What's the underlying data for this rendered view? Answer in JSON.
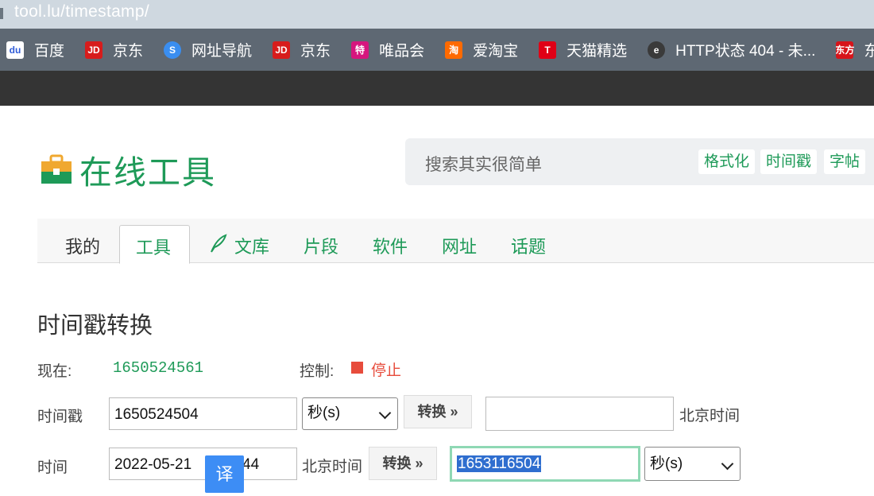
{
  "browser": {
    "url": "tool.lu/timestamp/",
    "bookmarks": [
      {
        "label": "百度",
        "icon": "baidu-icon",
        "glyph": "du",
        "color": "#2f5cd8"
      },
      {
        "label": "京东",
        "icon": "jd-icon",
        "glyph": "JD",
        "color": "#d71c1c"
      },
      {
        "label": "网址导航",
        "icon": "nav-site-icon",
        "glyph": "S",
        "color": "#3a8ef0"
      },
      {
        "label": "京东",
        "icon": "jd-icon",
        "glyph": "JD",
        "color": "#d71c1c"
      },
      {
        "label": "唯品会",
        "icon": "vip-icon",
        "glyph": "特",
        "color": "#d6167e"
      },
      {
        "label": "爱淘宝",
        "icon": "taobao-icon",
        "glyph": "淘",
        "color": "#ff6a00"
      },
      {
        "label": "天猫精选",
        "icon": "tmall-icon",
        "glyph": "T",
        "color": "#e00016"
      },
      {
        "label": "HTTP状态 404 - 未...",
        "icon": "edge-page-icon",
        "glyph": "e",
        "color": "#3a3a3a"
      },
      {
        "label": "东方头条",
        "icon": "dftt-icon",
        "glyph": "东方",
        "color": "#d7141a"
      }
    ]
  },
  "header": {
    "logo_text": "在线工具",
    "search_placeholder": "搜索其实很简单",
    "chips": [
      "格式化",
      "时间戳",
      "字帖"
    ]
  },
  "nav": {
    "items": [
      "我的",
      "工具",
      "文库",
      "片段",
      "软件",
      "网址",
      "话题"
    ],
    "active": "工具"
  },
  "tool": {
    "title": "时间戳转换",
    "now_label": "现在:",
    "now_value": "1650524561",
    "control_label": "控制:",
    "stop_label": "停止",
    "row1": {
      "label": "时间戳",
      "timestamp_value": "1650524504",
      "unit": "秒(s)",
      "convert_label": "转换 »",
      "result_value": "",
      "tz_label": "北京时间"
    },
    "row2": {
      "label": "时间",
      "datetime_value_left": "2022-05-21",
      "datetime_value_right": "1:44",
      "tz_label": "北京时间",
      "convert_label": "转换 »",
      "result_value": "1653116504",
      "unit": "秒(s)"
    },
    "translate_button": "译"
  },
  "colors": {
    "accent": "#1e9a58",
    "stop": "#e74c3c",
    "translate": "#3d8df5"
  }
}
